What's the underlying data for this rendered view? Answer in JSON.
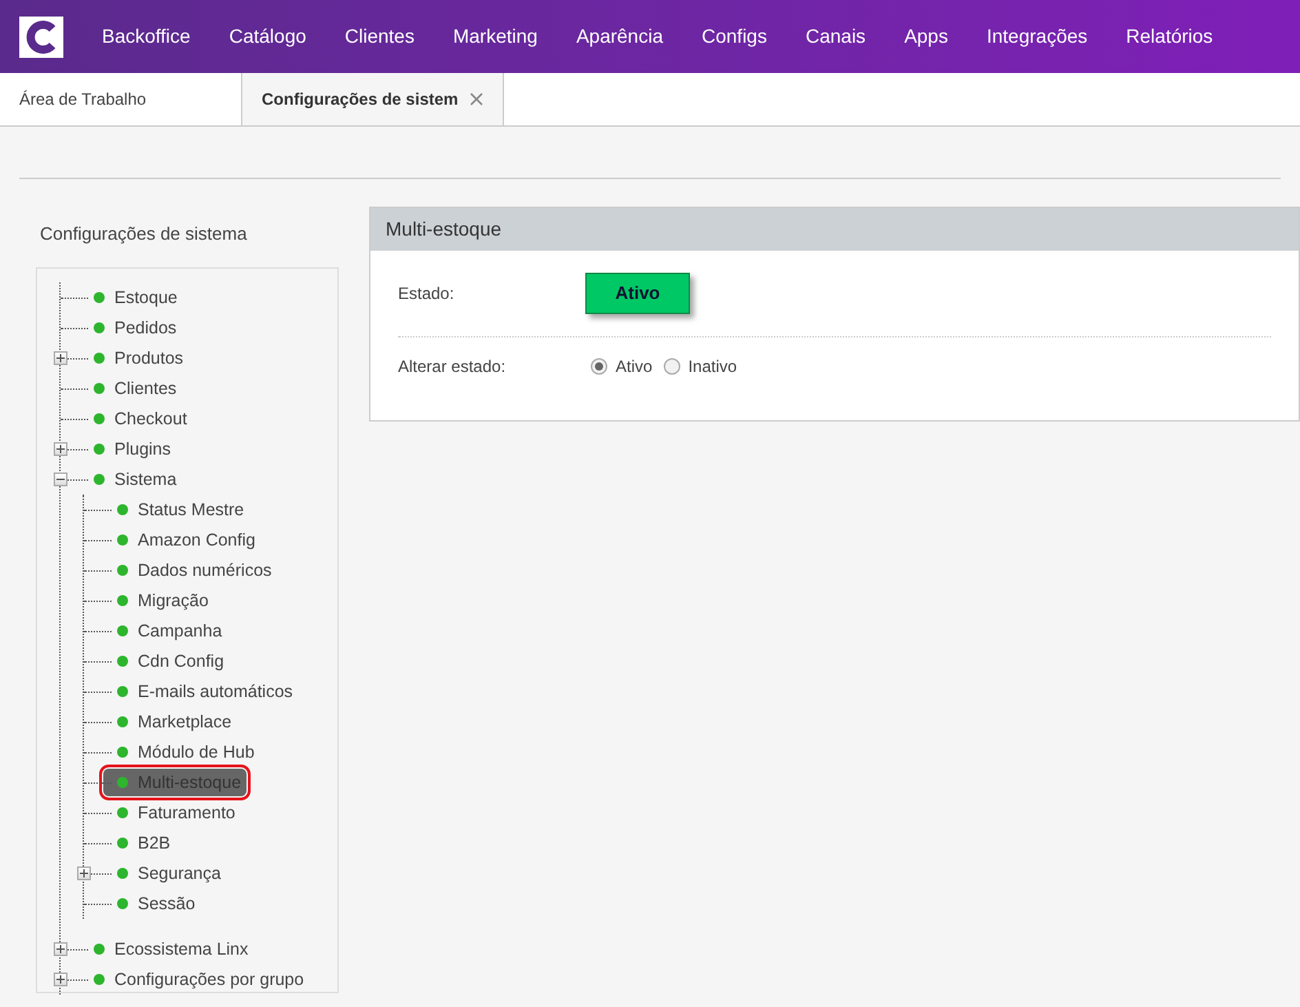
{
  "nav": {
    "items": [
      "Backoffice",
      "Catálogo",
      "Clientes",
      "Marketing",
      "Aparência",
      "Configs",
      "Canais",
      "Apps",
      "Integrações",
      "Relatórios"
    ]
  },
  "tabs": [
    {
      "label": "Área de Trabalho",
      "selected": false,
      "closable": false
    },
    {
      "label": "Configurações de sistem",
      "selected": true,
      "closable": true
    }
  ],
  "sidebar": {
    "title": "Configurações de sistema",
    "tree": [
      {
        "label": "Estoque",
        "selected": false
      },
      {
        "label": "Pedidos",
        "selected": false
      },
      {
        "label": "Produtos",
        "selected": false,
        "expanded": false
      },
      {
        "label": "Clientes",
        "selected": false
      },
      {
        "label": "Checkout",
        "selected": false
      },
      {
        "label": "Plugins",
        "selected": false,
        "expanded": false
      },
      {
        "label": "Sistema",
        "selected": false,
        "expanded": true,
        "children": [
          {
            "label": "Status Mestre",
            "selected": false
          },
          {
            "label": "Amazon Config",
            "selected": false
          },
          {
            "label": "Dados numéricos",
            "selected": false
          },
          {
            "label": "Migração",
            "selected": false
          },
          {
            "label": "Campanha",
            "selected": false
          },
          {
            "label": "Cdn Config",
            "selected": false
          },
          {
            "label": "E-mails automáticos",
            "selected": false
          },
          {
            "label": "Marketplace",
            "selected": false
          },
          {
            "label": "Módulo de Hub",
            "selected": false
          },
          {
            "label": "Multi-estoque",
            "selected": true
          },
          {
            "label": "Faturamento",
            "selected": false
          },
          {
            "label": "B2B",
            "selected": false
          },
          {
            "label": "Segurança",
            "selected": false,
            "expanded": false
          },
          {
            "label": "Sessão",
            "selected": false
          }
        ]
      },
      {
        "label": "Ecossistema Linx",
        "selected": false,
        "expanded": false
      },
      {
        "label": "Configurações por grupo",
        "selected": false,
        "expanded": false
      }
    ]
  },
  "panel": {
    "title": "Multi-estoque",
    "status_label": "Estado:",
    "status_badge": "Ativo",
    "change_label": "Alterar estado:",
    "options": [
      {
        "label": "Ativo",
        "selected": true
      },
      {
        "label": "Inativo",
        "selected": false
      }
    ]
  }
}
